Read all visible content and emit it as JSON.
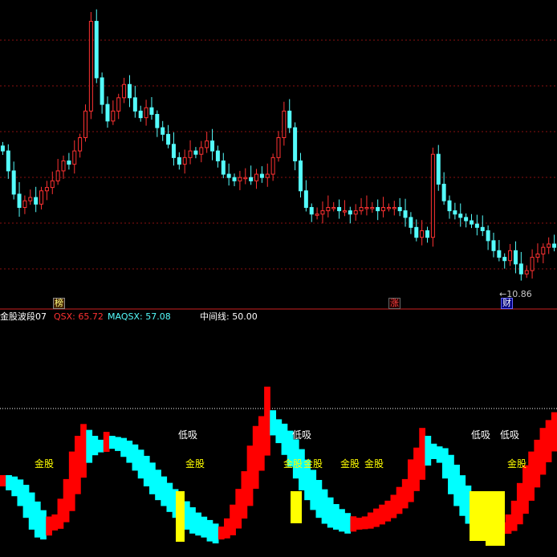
{
  "indicator": {
    "name": "金股波段07",
    "qsx_label": "QSX: 65.72",
    "maqsx_label": "MAQSX: 57.08",
    "mid_label": "中间线: 50.00"
  },
  "price_panel": {
    "low_marker": "←10.86",
    "tags": [
      "榜",
      "涨",
      "财"
    ]
  },
  "signals": {
    "gold": "金股",
    "low_buy": "低吸"
  },
  "colors": {
    "background": "#000000",
    "divider": "#cc2222",
    "grid": "#8a1010",
    "candle_up": "#ff3232",
    "candle_down": "#54fcfc",
    "wave_up": "#ff0000",
    "wave_down": "#00ffff",
    "bar_yellow": "#ffff00",
    "signal_text": "#ffff00",
    "lowbuy_text": "#ffffff",
    "qsx": "#ff3232",
    "maqsx": "#54fcfc"
  },
  "chart_data": [
    {
      "type": "candlestick",
      "title": "",
      "note": "price panel; approx closes per bar (estimated)",
      "close": [
        14.6,
        14.0,
        13.3,
        12.9,
        13.1,
        13.2,
        13.0,
        13.4,
        13.5,
        13.7,
        14.0,
        14.3,
        14.2,
        14.6,
        15.0,
        15.8,
        18.5,
        16.8,
        16.0,
        15.5,
        15.8,
        16.2,
        16.6,
        16.2,
        15.8,
        15.6,
        15.9,
        15.7,
        15.3,
        15.1,
        14.8,
        14.4,
        14.2,
        14.4,
        14.6,
        14.5,
        14.7,
        14.9,
        14.6,
        14.3,
        13.9,
        13.8,
        13.7,
        13.8,
        13.8,
        13.7,
        13.9,
        13.8,
        13.9,
        14.4,
        15.0,
        15.8,
        15.3,
        14.3,
        13.4,
        12.9,
        12.7,
        12.7,
        12.8,
        12.9,
        12.9,
        12.8,
        12.8,
        12.7,
        12.8,
        12.9,
        12.9,
        12.9,
        12.8,
        12.9,
        12.9,
        12.9,
        12.8,
        12.6,
        12.3,
        12.0,
        12.2,
        12.0,
        14.5,
        13.6,
        13.1,
        12.8,
        12.7,
        12.6,
        12.5,
        12.4,
        12.3,
        12.2,
        11.9,
        11.6,
        11.4,
        11.3,
        11.6,
        11.2,
        10.9,
        11.0,
        11.4,
        11.5,
        11.7,
        11.8,
        11.7
      ]
    },
    {
      "type": "area",
      "title": "金股波段07",
      "note": "indicator values (0-100 scale)",
      "qsx": 65.72,
      "maqsx": 57.08,
      "midline": 50.0,
      "values": [
        40,
        38,
        35,
        30,
        24,
        18,
        14,
        13,
        15,
        20,
        28,
        38,
        52,
        60,
        66,
        63,
        60,
        58,
        62,
        60,
        58,
        55,
        52,
        48,
        44,
        40,
        36,
        33,
        30,
        27,
        24,
        21,
        18,
        16,
        15,
        14,
        12,
        11,
        13,
        18,
        25,
        33,
        42,
        55,
        65,
        70,
        85,
        73,
        62,
        56,
        50,
        44,
        38,
        33,
        28,
        24,
        21,
        19,
        18,
        17,
        16,
        17,
        18,
        19,
        21,
        23,
        25,
        27,
        30,
        34,
        38,
        48,
        54,
        64,
        60,
        56,
        52,
        44,
        36,
        30,
        25,
        21,
        18,
        16,
        14,
        12,
        14,
        16,
        20,
        27,
        36,
        45,
        52,
        58,
        64,
        68,
        72
      ]
    }
  ]
}
